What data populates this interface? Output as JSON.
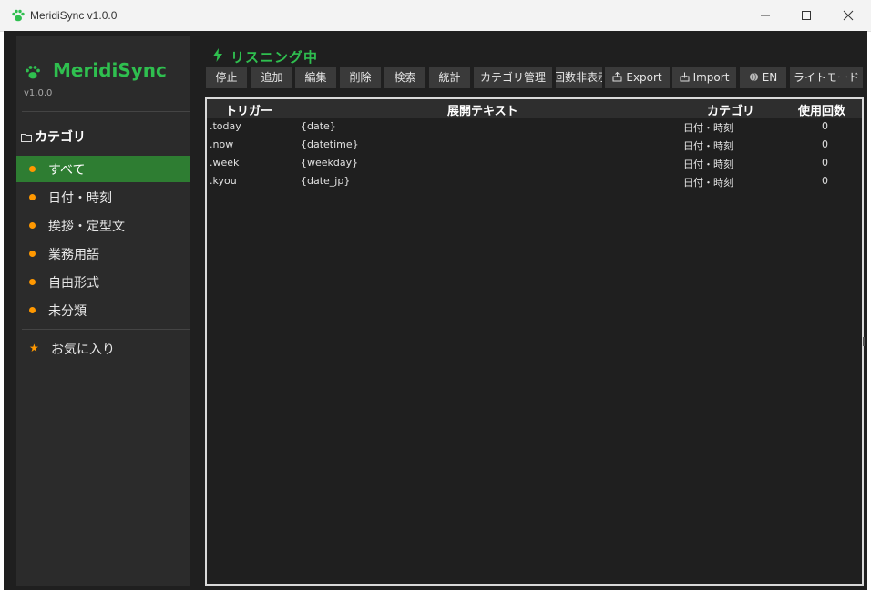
{
  "window": {
    "title": "MeridiSync v1.0.0"
  },
  "sidebar": {
    "app_name": "MeridiSync",
    "version": "v1.0.0",
    "categories_title": "カテゴリ",
    "items": [
      {
        "label": "すべて",
        "active": true
      },
      {
        "label": "日付・時刻",
        "active": false
      },
      {
        "label": "挨拶・定型文",
        "active": false
      },
      {
        "label": "業務用語",
        "active": false
      },
      {
        "label": "自由形式",
        "active": false
      },
      {
        "label": "未分類",
        "active": false
      }
    ],
    "favorites_label": "お気に入り"
  },
  "status": {
    "text": "リスニング中"
  },
  "toolbar": {
    "stop": "停止",
    "add": "追加",
    "edit": "編集",
    "delete": "削除",
    "search": "検索",
    "stats": "統計",
    "category_manage": "カテゴリ管理",
    "hide_count": "回数非表示",
    "export": "Export",
    "import": "Import",
    "language": "EN",
    "light_mode": "ライトモード"
  },
  "table": {
    "headers": {
      "trigger": "トリガー",
      "expansion": "展開テキスト",
      "category": "カテゴリ",
      "usage_count": "使用回数"
    },
    "rows": [
      {
        "trigger": ".today",
        "expansion": "{date}",
        "category": "日付・時刻",
        "count": "0"
      },
      {
        "trigger": ".now",
        "expansion": "{datetime}",
        "category": "日付・時刻",
        "count": "0"
      },
      {
        "trigger": ".week",
        "expansion": "{weekday}",
        "category": "日付・時刻",
        "count": "0"
      },
      {
        "trigger": ".kyou",
        "expansion": "{date_jp}",
        "category": "日付・時刻",
        "count": "0"
      }
    ]
  },
  "colors": {
    "accent_green": "#2fbf4f",
    "active_item": "#2e7d32",
    "bullet_orange": "#ff9800",
    "background": "#1f1f1f",
    "sidebar": "#2b2b2b",
    "button": "#3a3a3a"
  },
  "icons": {
    "app": "paw-icon",
    "status": "bolt-icon",
    "categories": "folder-icon",
    "favorites": "star-icon",
    "export": "export-icon",
    "import": "import-icon",
    "language": "globe-icon"
  }
}
